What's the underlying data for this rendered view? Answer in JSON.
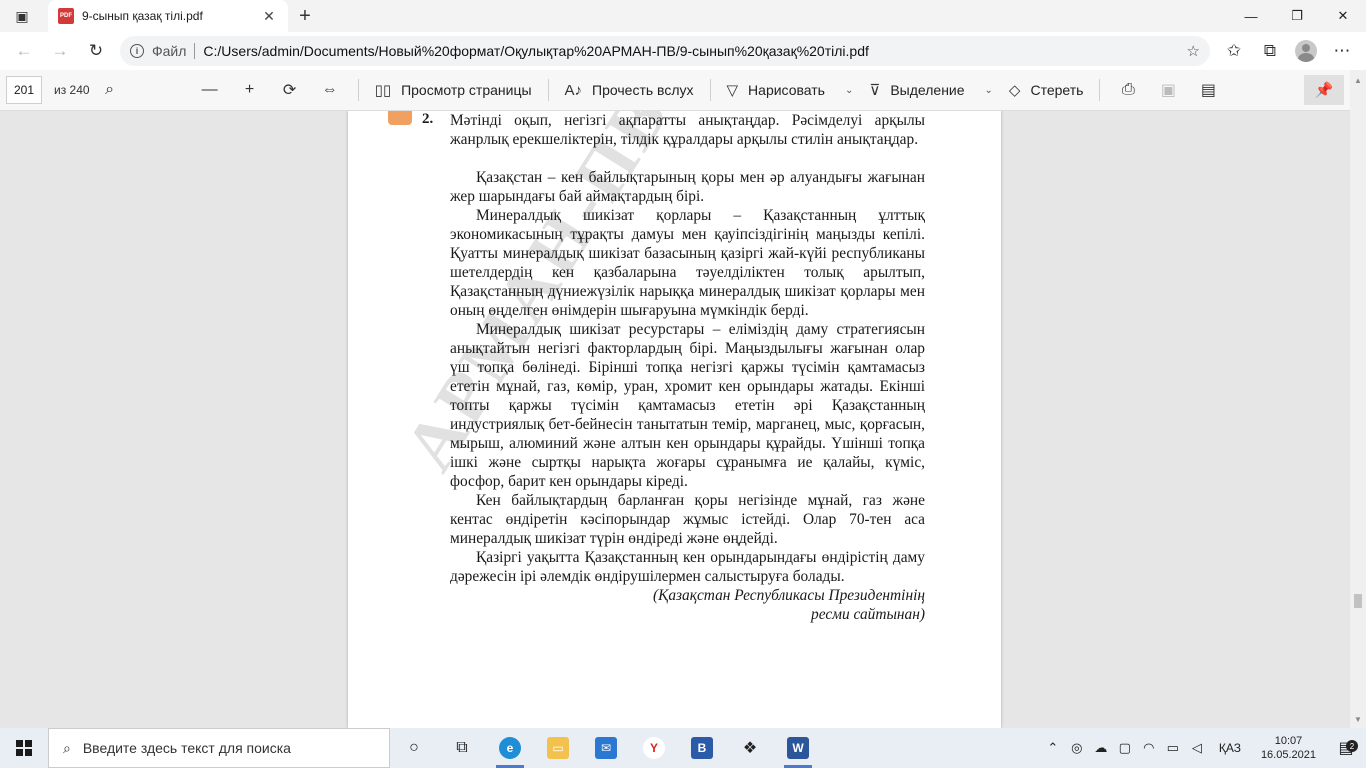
{
  "tab": {
    "title": "9-сынып қазақ тілі.pdf",
    "badge": "PDF"
  },
  "address": {
    "scheme_label": "Файл",
    "url": "C:/Users/admin/Documents/Новый%20формат/Оқулықтар%20АРМАН-ПВ/9-сынып%20қазақ%20тілі.pdf"
  },
  "pdf_toolbar": {
    "page_number": "201",
    "page_total": "из 240",
    "page_view_label": "Просмотр страницы",
    "read_aloud_label": "Прочесть вслух",
    "draw_label": "Нарисовать",
    "highlight_label": "Выделение",
    "erase_label": "Стереть"
  },
  "document": {
    "task_number": "2.",
    "task_text": "Мәтінді оқып, негізгі ақпаратты анықтаңдар. Рәсімделуі арқылы жанрлық ерекшеліктерін, тілдік құралдары арқылы стилін анықтаңдар.",
    "paragraphs": [
      "Қазақстан – кен байлықтарының қоры мен әр алуандығы жағынан жер шарындағы бай аймақтардың бірі.",
      "Минералдық шикізат қорлары – Қазақстанның ұлттық экономикасының тұрақты дамуы мен қауіпсіздігінің маңызды кепілі. Қуатты минералдық шикізат базасының қазіргі жай-күйі республиканы шетелдердің кен қазбаларына тәуелділіктен толық арылтып, Қазақстанның дүниежүзілік нарыққа минералдық шикізат қорлары мен оның өңделген өнімдерін шығаруына мүмкіндік берді.",
      "Минералдық шикізат ресурстары – еліміздің даму стратегиясын анықтайтын негізгі факторлардың бірі. Маңыздылығы жағынан олар үш топқа бөлінеді. Бірінші топқа негізгі қаржы түсімін қамтамасыз ететін мұнай, газ, көмір, уран, хромит кен орындары жатады. Екінші топты қаржы түсімін қамтамасыз ететін әрі Қазақстанның индустриялық бет-бейнесін танытатын темір, марганец, мыс, қорғасын, мырыш, алюминий және алтын кен орындары құрайды. Үшінші топқа ішкі және сыртқы нарықта жоғары сұранымға ие қалайы, күміс, фосфор, барит кен орындары кіреді.",
      "Кен байлықтардың барланған қоры негізінде мұнай, газ және кентас өндіретін кәсіпорындар жұмыс істейді. Олар 70-тен аса минералдық шикізат түрін өндіреді және өңдейді.",
      "Қазіргі уақытта Қазақстанның кен орындарындағы өндірістің даму дәрежесін ірі әлемдік өндірушілермен салыстыруға болады."
    ],
    "source_line1": "(Қазақстан Республикасы Президентінің",
    "source_line2": "ресми сайтынан)",
    "watermark": "АРМАН-ПВ"
  },
  "taskbar": {
    "search_placeholder": "Введите здесь текст для поиска",
    "language": "ҚАЗ",
    "time": "10:07",
    "date": "16.05.2021",
    "notification_count": "2"
  }
}
